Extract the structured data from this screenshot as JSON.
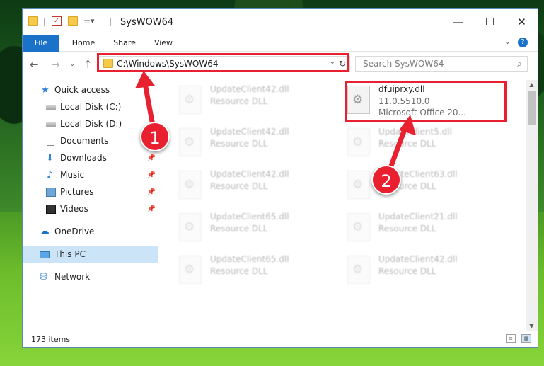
{
  "window": {
    "title": "SysWOW64",
    "controls": {
      "minimize": "—",
      "maximize": "☐",
      "close": "✕"
    }
  },
  "ribbon": {
    "tabs": [
      "File",
      "Home",
      "Share",
      "View"
    ],
    "help": "?",
    "expand": "⌄"
  },
  "nav": {
    "back": "←",
    "forward": "→",
    "recent": "⌄",
    "up": "↑"
  },
  "address": {
    "path": "C:\\Windows\\SysWOW64",
    "dropdown": "⌄",
    "refresh": "↻"
  },
  "search": {
    "placeholder": "Search SysWOW64",
    "icon": "⌕"
  },
  "sidebar": {
    "items": [
      {
        "label": "Quick access",
        "icon": "star-icon"
      },
      {
        "label": "Local Disk (C:)",
        "icon": "drive-icon"
      },
      {
        "label": "Local Disk (D:)",
        "icon": "drive-icon"
      },
      {
        "label": "Documents",
        "icon": "documents-icon"
      },
      {
        "label": "Downloads",
        "icon": "download-icon"
      },
      {
        "label": "Music",
        "icon": "music-icon"
      },
      {
        "label": "Pictures",
        "icon": "pictures-icon"
      },
      {
        "label": "Videos",
        "icon": "videos-icon"
      },
      {
        "label": "OneDrive",
        "icon": "cloud-icon"
      },
      {
        "label": "This PC",
        "icon": "computer-icon"
      },
      {
        "label": "Network",
        "icon": "network-icon"
      }
    ],
    "pin": "📌"
  },
  "files": {
    "highlighted": {
      "name": "dfuiprxy.dll",
      "version": "11.0.5510.0",
      "description": "Microsoft Office 20..."
    },
    "blurred": [
      {
        "name": "UpdateClient42.dll",
        "type": "Resource DLL"
      },
      {
        "name": "UpdateClient42.dll",
        "type": "Resource DLL"
      },
      {
        "name": "UpdateClient5.dll",
        "type": "Resource DLL"
      },
      {
        "name": "UpdateClient42.dll",
        "type": "Resource DLL"
      },
      {
        "name": "UpdateClient63.dll",
        "type": "Resource DLL"
      },
      {
        "name": "UpdateClient65.dll",
        "type": "Resource DLL"
      },
      {
        "name": "UpdateClient21.dll",
        "type": "Resource DLL"
      },
      {
        "name": "UpdateClient65.dll",
        "type": "Resource DLL"
      },
      {
        "name": "UpdateClient42.dll",
        "type": "Resource DLL"
      }
    ]
  },
  "status": {
    "item_count": "173 items"
  },
  "annotations": {
    "badge1": "1",
    "badge2": "2"
  },
  "colors": {
    "accent": "#1a73c8",
    "highlight": "#e8202f",
    "selected": "#cce4f7"
  }
}
